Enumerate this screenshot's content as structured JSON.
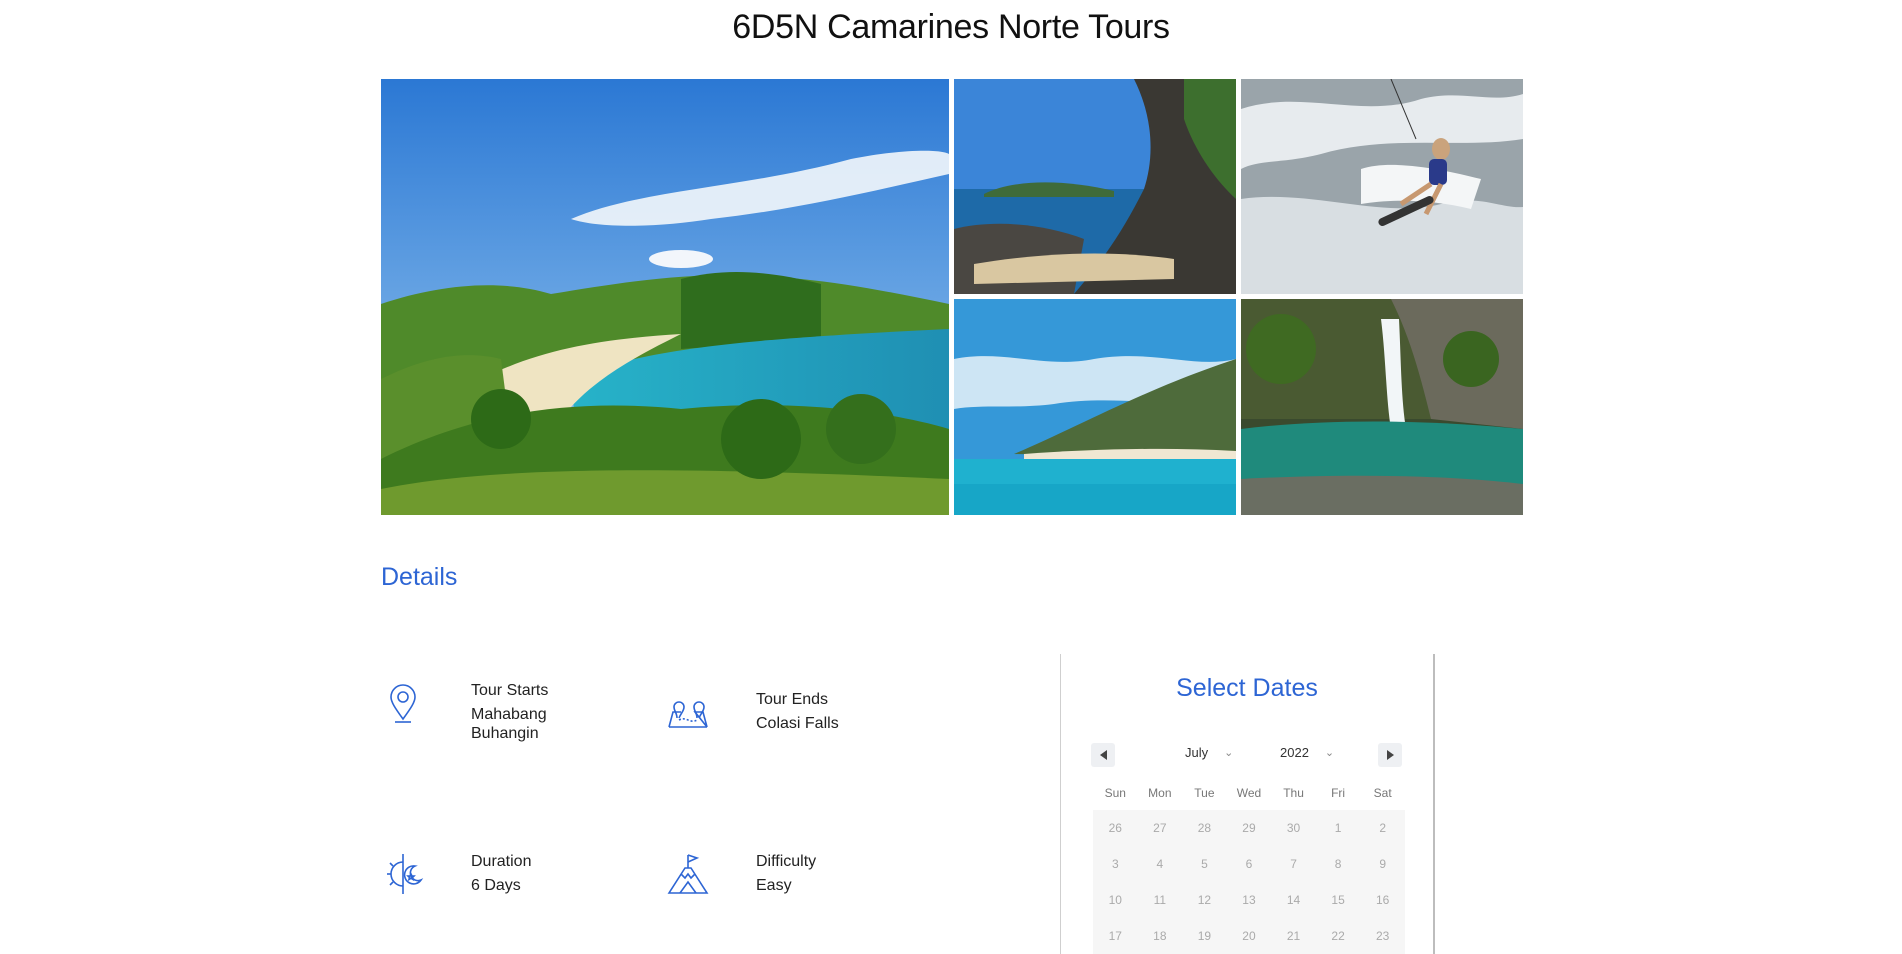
{
  "page": {
    "title": "6D5N Camarines Norte Tours"
  },
  "gallery": {
    "images": [
      {
        "name": "beach-bay-photo"
      },
      {
        "name": "rocky-coast-photo"
      },
      {
        "name": "kitesurfer-photo"
      },
      {
        "name": "island-photo"
      },
      {
        "name": "waterfall-photo"
      }
    ]
  },
  "details": {
    "heading": "Details",
    "items": [
      {
        "icon": "location-pin-icon",
        "label": "Tour Starts",
        "value": "Mahabang Buhangin"
      },
      {
        "icon": "map-route-icon",
        "label": "Tour Ends",
        "value": "Colasi Falls"
      },
      {
        "icon": "moon-sun-icon",
        "label": "Duration",
        "value": "6 Days"
      },
      {
        "icon": "mountain-flag-icon",
        "label": "Difficulty",
        "value": "Easy"
      }
    ]
  },
  "calendar": {
    "title": "Select Dates",
    "month": "July",
    "year": "2022",
    "weekdays": [
      "Sun",
      "Mon",
      "Tue",
      "Wed",
      "Thu",
      "Fri",
      "Sat"
    ],
    "weeks": [
      [
        "26",
        "27",
        "28",
        "29",
        "30",
        "1",
        "2"
      ],
      [
        "3",
        "4",
        "5",
        "6",
        "7",
        "8",
        "9"
      ],
      [
        "10",
        "11",
        "12",
        "13",
        "14",
        "15",
        "16"
      ],
      [
        "17",
        "18",
        "19",
        "20",
        "21",
        "22",
        "23"
      ]
    ]
  },
  "colors": {
    "accent": "#2d65d4",
    "text": "#1e1e1e",
    "muted": "#aaaaaa"
  }
}
